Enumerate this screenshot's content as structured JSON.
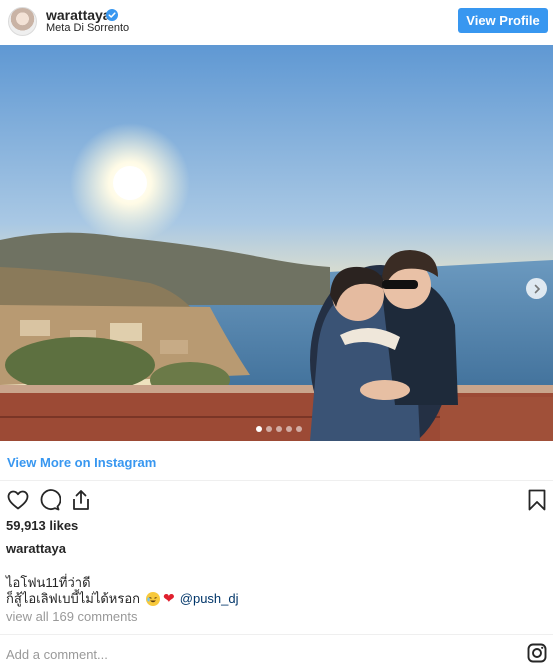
{
  "header": {
    "username": "warattaya",
    "location": "Meta Di Sorrento",
    "view_profile_label": "View Profile"
  },
  "post": {
    "carousel_total": 5,
    "carousel_active": 1,
    "view_more_label": "View More on Instagram",
    "likes_text": "59,913 likes",
    "owner": "warattaya",
    "caption_line1": "ไอโฟน11ที่ว่าดี",
    "caption_line2": "ก็สู้ไอเลิฟเบบี้ไม่ได้หรอก",
    "caption_mention": "@push_dj",
    "view_all_comments": "view all 169 comments",
    "comment_placeholder": "Add a comment..."
  },
  "icons": {
    "verified": "verified-badge-icon",
    "like": "heart-icon",
    "comment": "comment-bubble-icon",
    "share": "share-icon",
    "save": "bookmark-icon",
    "next": "chevron-right-icon",
    "instagram": "instagram-logo-icon"
  },
  "colors": {
    "accent": "#3897f0",
    "text": "#262626",
    "muted": "#999999",
    "mention": "#003569"
  }
}
